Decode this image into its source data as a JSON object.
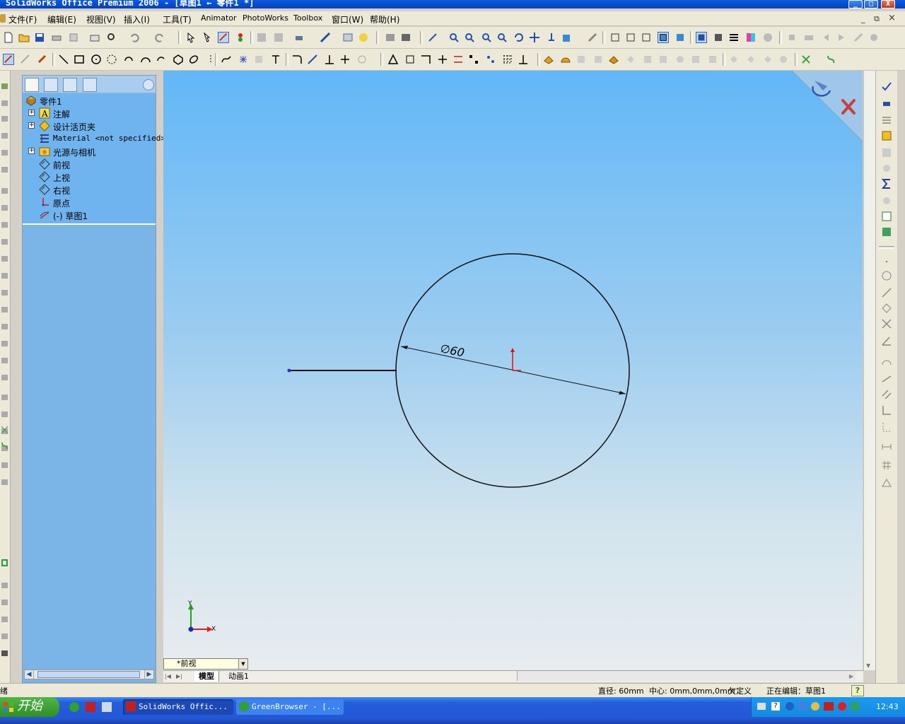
{
  "window": {
    "title": "SolidWorks Office Premium 2006 - [草图1 ← 零件1 *]",
    "min_glyph": "_",
    "max_glyph": "□",
    "close_glyph": "X"
  },
  "menu": {
    "items": [
      "文件(F)",
      "编辑(E)",
      "视图(V)",
      "插入(I)",
      "工具(T)",
      "Animator",
      "PhotoWorks",
      "Toolbox",
      "窗口(W)",
      "帮助(H)"
    ],
    "mdi_min": "_",
    "mdi_restore": "⧉",
    "mdi_close": "×"
  },
  "feature_tree": {
    "items": [
      {
        "label": "零件1",
        "icon": "part-icon",
        "expandable": false
      },
      {
        "label": "注解",
        "icon": "annotations-icon",
        "expandable": true
      },
      {
        "label": "设计活页夹",
        "icon": "design-binder-icon",
        "expandable": true
      },
      {
        "label": "Material <not specified>",
        "icon": "material-icon",
        "expandable": false
      },
      {
        "label": "光源与相机",
        "icon": "lights-camera-icon",
        "expandable": true
      },
      {
        "label": "前视",
        "icon": "plane-icon",
        "expandable": false
      },
      {
        "label": "上视",
        "icon": "plane-icon",
        "expandable": false
      },
      {
        "label": "右视",
        "icon": "plane-icon",
        "expandable": false
      },
      {
        "label": "原点",
        "icon": "origin-icon",
        "expandable": false
      },
      {
        "label": "(-) 草图1",
        "icon": "sketch-icon",
        "expandable": false
      }
    ],
    "expand_glyph": "+"
  },
  "sketch": {
    "dimension_label": "∅60",
    "axis_x_label": "X",
    "axis_y_label": "Y"
  },
  "view": {
    "selected": "*前视"
  },
  "bottom_tabs": [
    "模型",
    "动画1"
  ],
  "status": {
    "left": "绪",
    "diameter": "直径: 60mm",
    "center": "中心: 0mm,0mm,0mm",
    "state": "欠定义",
    "editing": "正在编辑：草图1",
    "help": "?"
  },
  "taskbar": {
    "start": "开始",
    "tasks": [
      "SolidWorks Offic...",
      "GreenBrowser - [..."
    ],
    "clock": "12:43"
  },
  "colors": {
    "accent_blue": "#0a5ae0",
    "sketch_line": "#111111",
    "origin_red": "#e01010"
  }
}
